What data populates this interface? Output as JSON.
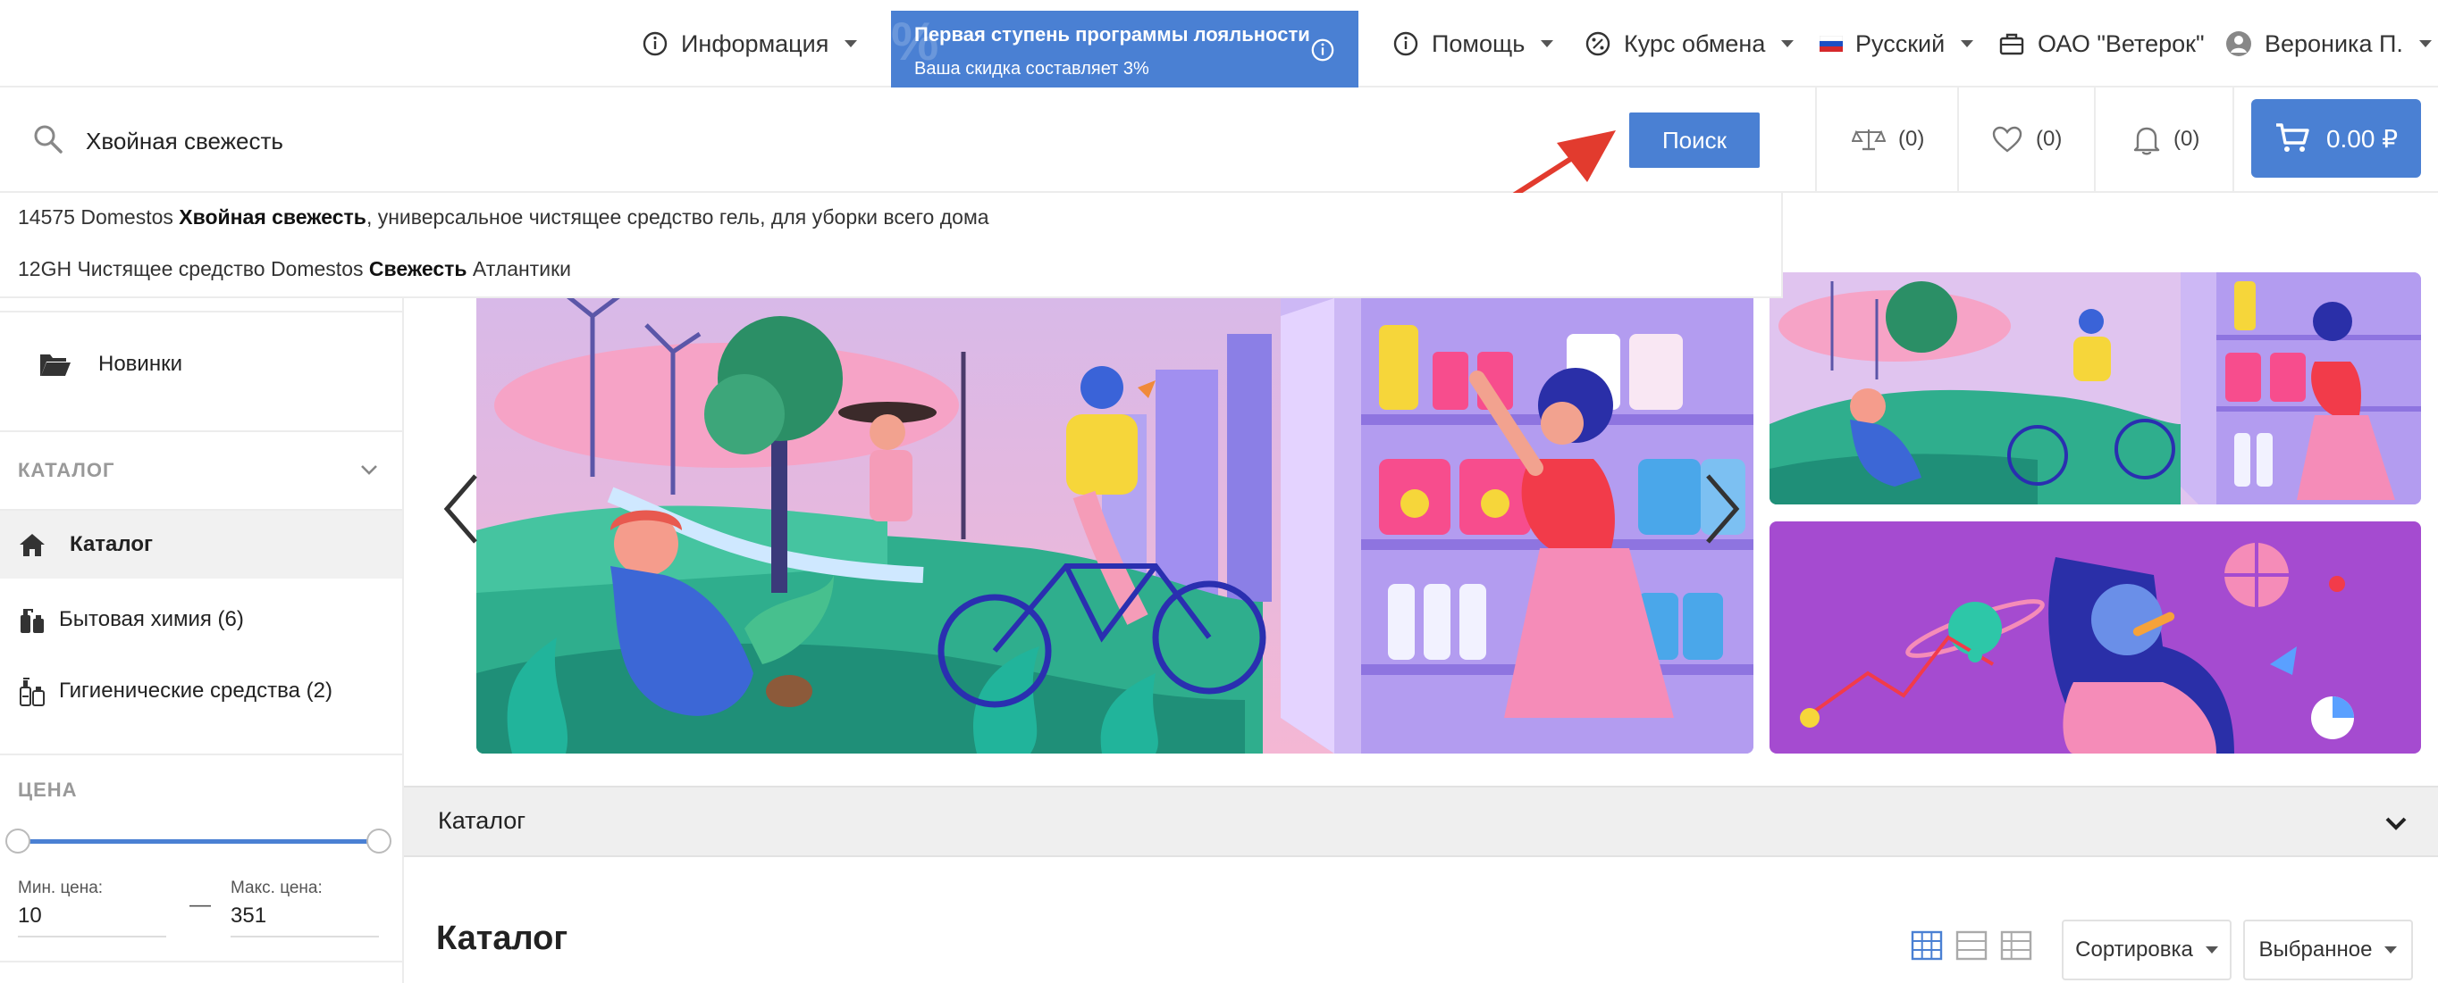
{
  "topbar": {
    "info_label": "Информация",
    "loyalty_title": "Первая ступень программы лояльности",
    "loyalty_sub": "Ваша скидка составляет 3%",
    "help_label": "Помощь",
    "exchange_label": "Курс обмена",
    "language_label": "Русский",
    "company_label": "ОАО \"Ветерок\"",
    "user_label": "Вероника П."
  },
  "search": {
    "value": "Хвойная свежесть",
    "button_label": "Поиск",
    "suggestions": [
      {
        "prefix": "14575 Domestos ",
        "highlight": "Хвойная свежесть",
        "suffix": ", универсальное чистящее средство гель, для уборки всего дома"
      },
      {
        "prefix": "12GH Чистящее средство Domestos ",
        "highlight": "Свежесть",
        "suffix": " Атлантики"
      }
    ]
  },
  "counters": {
    "compare": "(0)",
    "favorites": "(0)",
    "notifications": "(0)"
  },
  "cart": {
    "total": "0.00 ₽"
  },
  "sidebar": {
    "new_label": "Новинки",
    "catalog_header": "КАТАЛОГ",
    "catalog_label": "Каталог",
    "items": [
      {
        "label": "Бытовая химия (6)"
      },
      {
        "label": "Гигиенические средства (2)"
      }
    ],
    "price_header": "ЦЕНА",
    "min_label": "Мин. цена:",
    "max_label": "Макс. цена:",
    "min_value": "10",
    "max_value": "351",
    "dash": "—"
  },
  "catalog": {
    "bar_label": "Каталог",
    "title": "Каталог",
    "sort_label": "Сортировка",
    "filter_label": "Выбранное"
  },
  "colors": {
    "accent": "#4a80d3",
    "arrow": "#e23b2e"
  }
}
